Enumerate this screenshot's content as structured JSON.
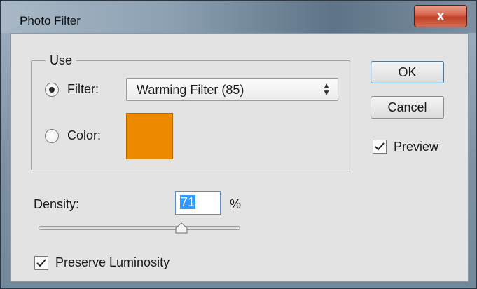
{
  "window": {
    "title": "Photo Filter",
    "close_glyph": "x"
  },
  "use_group": {
    "label": "Use",
    "filter_label": "Filter:",
    "filter_selected": "Warming Filter (85)",
    "filter_checked": true,
    "color_label": "Color:",
    "color_swatch": "#ee8a00"
  },
  "buttons": {
    "ok": "OK",
    "cancel": "Cancel"
  },
  "preview": {
    "label": "Preview",
    "checked": true
  },
  "density": {
    "label": "Density:",
    "value": "71",
    "unit": "%",
    "slider_fraction": 0.71
  },
  "preserve_luminosity": {
    "label": "Preserve Luminosity",
    "checked": true
  }
}
